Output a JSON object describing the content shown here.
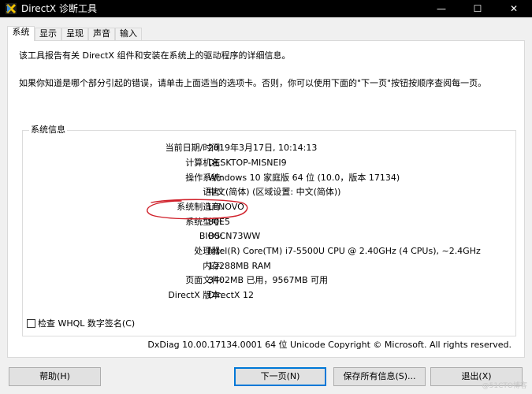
{
  "window": {
    "title": "DirectX 诊断工具",
    "minimize_glyph": "—",
    "maximize_glyph": "☐",
    "close_glyph": "✕",
    "icon": "directx-icon"
  },
  "tabs": [
    {
      "label": "系统",
      "active": true
    },
    {
      "label": "显示",
      "active": false
    },
    {
      "label": "呈现",
      "active": false
    },
    {
      "label": "声音",
      "active": false
    },
    {
      "label": "输入",
      "active": false
    }
  ],
  "intro": {
    "line1": "该工具报告有关 DirectX 组件和安装在系统上的驱动程序的详细信息。",
    "line2": "如果你知道是哪个部分引起的错误，请单击上面适当的选项卡。否则，你可以使用下面的\"下一页\"按钮按顺序查阅每一页。"
  },
  "system_info": {
    "title": "系统信息",
    "rows": [
      {
        "label": "当前日期/时间:",
        "value": "2019年3月17日, 10:14:13"
      },
      {
        "label": "计算机名:",
        "value": "DESKTOP-MISNEI9"
      },
      {
        "label": "操作系统:",
        "value": "Windows 10 家庭版 64 位 (10.0，版本 17134)"
      },
      {
        "label": "语言:",
        "value": "中文(简体) (区域设置: 中文(简体))"
      },
      {
        "label": "系统制造商:",
        "value": "LENOVO"
      },
      {
        "label": "系统型号:",
        "value": "80E5"
      },
      {
        "label": "BIOS:",
        "value": "B0CN73WW"
      },
      {
        "label": "处理器:",
        "value": "Intel(R) Core(TM) i7-5500U CPU @ 2.40GHz (4 CPUs), ~2.4GHz"
      },
      {
        "label": "内存:",
        "value": "12288MB RAM"
      },
      {
        "label": "页面文件:",
        "value": "3402MB 已用，9567MB 可用"
      },
      {
        "label": "DirectX 版本:",
        "value": "DirectX 12"
      }
    ],
    "highlight_color": "#d0202a"
  },
  "whql": {
    "label": "检查 WHQL 数字签名(C)",
    "checked": false
  },
  "footer": {
    "version": "DxDiag 10.00.17134.0001 64 位 Unicode  Copyright © Microsoft. All rights reserved."
  },
  "buttons": {
    "help": "帮助(H)",
    "next": "下一页(N)",
    "save": "保存所有信息(S)...",
    "exit": "退出(X)"
  },
  "watermark": "@51CTO博客",
  "colors": {
    "accent": "#0078d7",
    "titlebar": "#000000"
  }
}
